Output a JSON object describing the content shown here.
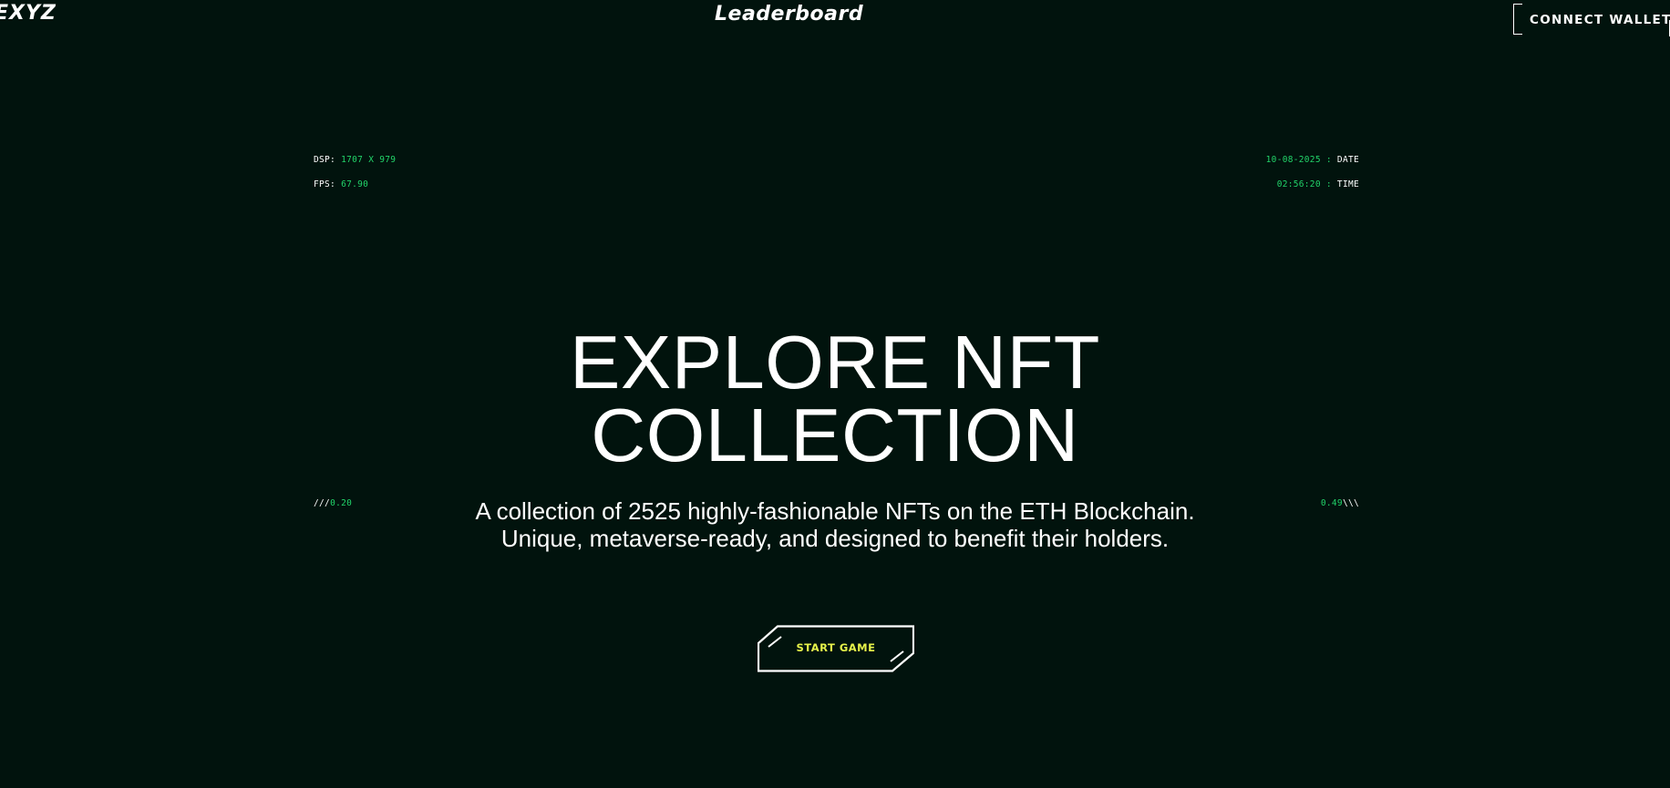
{
  "header": {
    "logo": "EXYZ",
    "nav_leaderboard": "Leaderboard",
    "connect_wallet": "CONNECT WALLET"
  },
  "hud": {
    "dsp_label": "DSP:",
    "dsp_value": "1707 X 979",
    "fps_label": "FPS:",
    "fps_value": "67.90",
    "date_value": "10-08-2025 :",
    "date_label": "DATE",
    "time_value": "02:56:20 :",
    "time_label": "TIME",
    "left_slashes": "///",
    "left_value": "0.20",
    "right_value": "0.49",
    "right_slashes": "\\\\\\"
  },
  "hero": {
    "title_line1": "EXPLORE NFT",
    "title_line2": "COLLECTION",
    "subtitle": "A collection of 2525 highly-fashionable NFTs on the ETH Blockchain. Unique, metaverse-ready, and designed to benefit their holders.",
    "start_button": "START GAME"
  },
  "colors": {
    "background": "#01130d",
    "hud_green": "#22d46a",
    "button_text": "#e6f24a",
    "text": "#ffffff"
  }
}
